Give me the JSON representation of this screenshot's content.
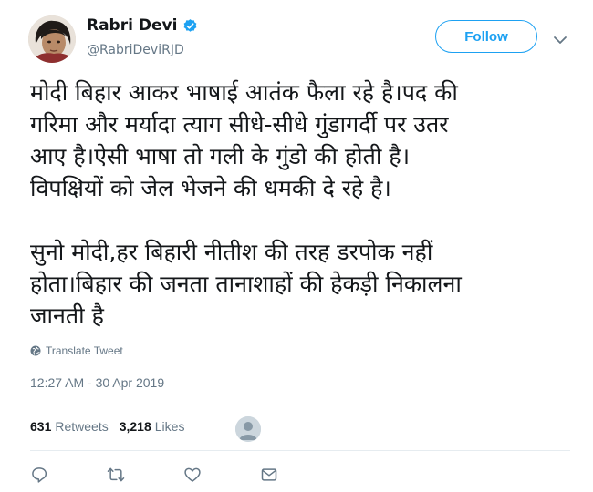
{
  "author": {
    "display_name": "Rabri Devi",
    "handle": "@RabriDeviRJD",
    "verified": true
  },
  "follow_label": "Follow",
  "tweet": {
    "lines": [
      "मोदी बिहार आकर भाषाई आतंक फैला रहे है।पद की",
      "गरिमा और मर्यादा त्याग सीधे-सीधे गुंडागर्दी पर उतर",
      "आए है।ऐसी भाषा तो गली के गुंडो की होती है।",
      "विपक्षियों को जेल भेजने की धमकी दे रहे है।",
      "सुनो मोदी,हर बिहारी नीतीश की तरह डरपोक नहीं",
      "होता।बिहार की जनता तानाशाहों की हेकड़ी निकालना",
      "जानती है"
    ]
  },
  "translate_label": "Translate Tweet",
  "timestamp": "12:27 AM - 30 Apr 2019",
  "stats": {
    "retweets_count": "631",
    "retweets_label": "Retweets",
    "likes_count": "3,218",
    "likes_label": "Likes"
  },
  "colors": {
    "accent": "#1da1f2",
    "secondary_text": "#657786",
    "divider": "#e6ecf0"
  },
  "icons": {
    "verified": "verified-badge-icon",
    "menu": "chevron-down-icon",
    "translate": "globe-icon",
    "reply": "reply-icon",
    "retweet": "retweet-icon",
    "like": "heart-icon",
    "message": "envelope-icon"
  }
}
